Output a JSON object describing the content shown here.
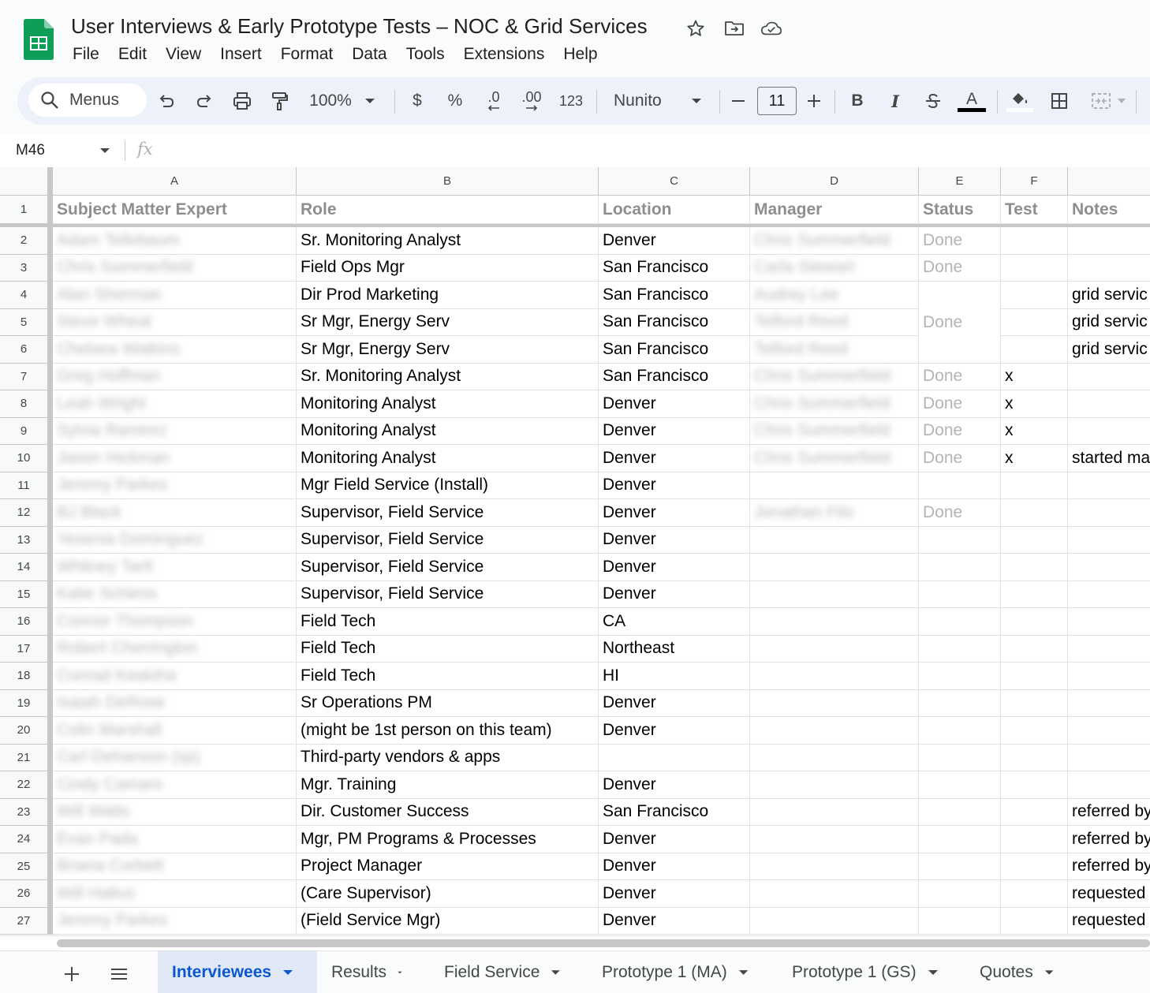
{
  "document": {
    "title": "User Interviews & Early Prototype Tests – NOC & Grid Services"
  },
  "menubar": [
    "File",
    "Edit",
    "View",
    "Insert",
    "Format",
    "Data",
    "Tools",
    "Extensions",
    "Help"
  ],
  "toolbar": {
    "search_label": "Menus",
    "zoom": "100%",
    "currency": "$",
    "percent": "%",
    "decrease_decimal": ".0",
    "increase_decimal": ".00",
    "number_format": "123",
    "font": "Nunito",
    "font_size": "11",
    "bold": "B",
    "italic": "I",
    "text_color_glyph": "A"
  },
  "formula_bar": {
    "cell_ref": "M46",
    "fx": "fx",
    "value": ""
  },
  "grid": {
    "columns": [
      "A",
      "B",
      "C",
      "D",
      "E",
      "F"
    ],
    "header_row": [
      "Subject Matter Expert",
      "Role",
      "Location",
      "Manager",
      "Status",
      "Test",
      "Notes"
    ],
    "rows": [
      {
        "num": "2",
        "sme": "Adam Tellebaum",
        "role": "Sr. Monitoring Analyst",
        "location": "Denver",
        "manager": "Chris Summerfield",
        "status": "Done",
        "test": "",
        "notes": ""
      },
      {
        "num": "3",
        "sme": "Chris Summerfield",
        "role": "Field Ops Mgr",
        "location": "San Francisco",
        "manager": "Carla Stewart",
        "status": "Done",
        "test": "",
        "notes": ""
      },
      {
        "num": "4",
        "sme": "Alan Sherman",
        "role": "Dir Prod Marketing",
        "location": "San Francisco",
        "manager": "Audrey Lee",
        "status": "",
        "test": "",
        "notes": "grid servic"
      },
      {
        "num": "5",
        "sme": "Steve Wheat",
        "role": "Sr Mgr, Energy Serv",
        "location": "San Francisco",
        "manager": "Telford Reed",
        "status": "Done",
        "test": "",
        "notes": "grid servic"
      },
      {
        "num": "6",
        "sme": "Chelsea Watkins",
        "role": "Sr Mgr, Energy Serv",
        "location": "San Francisco",
        "manager": "Telford Reed",
        "status": "",
        "test": "",
        "notes": "grid servic"
      },
      {
        "num": "7",
        "sme": "Greg Hoffman",
        "role": "Sr. Monitoring Analyst",
        "location": "San Francisco",
        "manager": "Chris Summerfield",
        "status": "Done",
        "test": "x",
        "notes": ""
      },
      {
        "num": "8",
        "sme": "Leah Wright",
        "role": "Monitoring Analyst",
        "location": "Denver",
        "manager": "Chris Summerfield",
        "status": "Done",
        "test": "x",
        "notes": ""
      },
      {
        "num": "9",
        "sme": "Sylvia Ramirez",
        "role": "Monitoring Analyst",
        "location": "Denver",
        "manager": "Chris Summerfield",
        "status": "Done",
        "test": "x",
        "notes": ""
      },
      {
        "num": "10",
        "sme": "Jason Hickman",
        "role": "Monitoring Analyst",
        "location": "Denver",
        "manager": "Chris Summerfield",
        "status": "Done",
        "test": "x",
        "notes": "started ma"
      },
      {
        "num": "11",
        "sme": "Jeremy Parkes",
        "role": "Mgr Field Service (Install)",
        "location": "Denver",
        "manager": "",
        "status": "",
        "test": "",
        "notes": ""
      },
      {
        "num": "12",
        "sme": "BJ Black",
        "role": "Supervisor, Field Service",
        "location": "Denver",
        "manager": "Jonathan Filo",
        "status": "Done",
        "test": "",
        "notes": ""
      },
      {
        "num": "13",
        "sme": "Yesenia Dominguez",
        "role": "Supervisor, Field Service",
        "location": "Denver",
        "manager": "",
        "status": "",
        "test": "",
        "notes": ""
      },
      {
        "num": "14",
        "sme": "Whitney Tartt",
        "role": "Supervisor, Field Service",
        "location": "Denver",
        "manager": "",
        "status": "",
        "test": "",
        "notes": ""
      },
      {
        "num": "15",
        "sme": "Katie Schiess",
        "role": "Supervisor, Field Service",
        "location": "Denver",
        "manager": "",
        "status": "",
        "test": "",
        "notes": ""
      },
      {
        "num": "16",
        "sme": "Connor Thompson",
        "role": "Field Tech",
        "location": "CA",
        "manager": "",
        "status": "",
        "test": "",
        "notes": ""
      },
      {
        "num": "17",
        "sme": "Robert Cherrington",
        "role": "Field Tech",
        "location": "Northeast",
        "manager": "",
        "status": "",
        "test": "",
        "notes": ""
      },
      {
        "num": "18",
        "sme": "Conrad Kealoha",
        "role": "Field Tech",
        "location": "HI",
        "manager": "",
        "status": "",
        "test": "",
        "notes": ""
      },
      {
        "num": "19",
        "sme": "Isaiah DeRose",
        "role": "Sr Operations PM",
        "location": "Denver",
        "manager": "",
        "status": "",
        "test": "",
        "notes": ""
      },
      {
        "num": "20",
        "sme": "Colin Marshall",
        "role": "(might be 1st person on this team)",
        "location": "Denver",
        "manager": "",
        "status": "",
        "test": "",
        "notes": ""
      },
      {
        "num": "21",
        "sme": "Carl Dehanson (sp)",
        "role": "Third-party vendors & apps",
        "location": "",
        "manager": "",
        "status": "",
        "test": "",
        "notes": ""
      },
      {
        "num": "22",
        "sme": "Cindy Camaro",
        "role": "Mgr. Training",
        "location": "Denver",
        "manager": "",
        "status": "",
        "test": "",
        "notes": ""
      },
      {
        "num": "23",
        "sme": "Will Watts",
        "role": "Dir. Customer Success",
        "location": "San Francisco",
        "manager": "",
        "status": "",
        "test": "",
        "notes": "referred by"
      },
      {
        "num": "24",
        "sme": "Evan Pada",
        "role": "Mgr, PM Programs & Processes",
        "location": "Denver",
        "manager": "",
        "status": "",
        "test": "",
        "notes": "referred by"
      },
      {
        "num": "25",
        "sme": "Briana Corbett",
        "role": "Project Manager",
        "location": "Denver",
        "manager": "",
        "status": "",
        "test": "",
        "notes": "referred by"
      },
      {
        "num": "26",
        "sme": "Will Haltus",
        "role": "(Care Supervisor)",
        "location": "Denver",
        "manager": "",
        "status": "",
        "test": "",
        "notes": "requested"
      },
      {
        "num": "27",
        "sme": "Jeremy Parkes",
        "role": "(Field Service Mgr)",
        "location": "Denver",
        "manager": "",
        "status": "",
        "test": "",
        "notes": "requested"
      }
    ]
  },
  "sheet_tabs": [
    {
      "label": "Interviewees",
      "active": true
    },
    {
      "label": "Results",
      "active": false
    },
    {
      "label": "Field Service",
      "active": false
    },
    {
      "label": "Prototype 1 (MA)",
      "active": false
    },
    {
      "label": "Prototype 1 (GS)",
      "active": false
    },
    {
      "label": "Quotes",
      "active": false
    }
  ],
  "colors": {
    "accent": "#0b57d0",
    "sheets_green": "#0f9d58",
    "toolbar_bg": "#edf2fa",
    "header_bg": "#f8f9fa"
  },
  "icons": {
    "logo": "google-sheets-logo-icon",
    "star": "star-icon",
    "move": "move-to-folder-icon",
    "cloud": "cloud-saved-icon",
    "search": "search-icon",
    "undo": "undo-icon",
    "redo": "redo-icon",
    "print": "print-icon",
    "paint_format": "paint-format-icon",
    "fill_color": "fill-color-icon",
    "borders": "borders-icon",
    "merge": "merge-cells-icon"
  }
}
